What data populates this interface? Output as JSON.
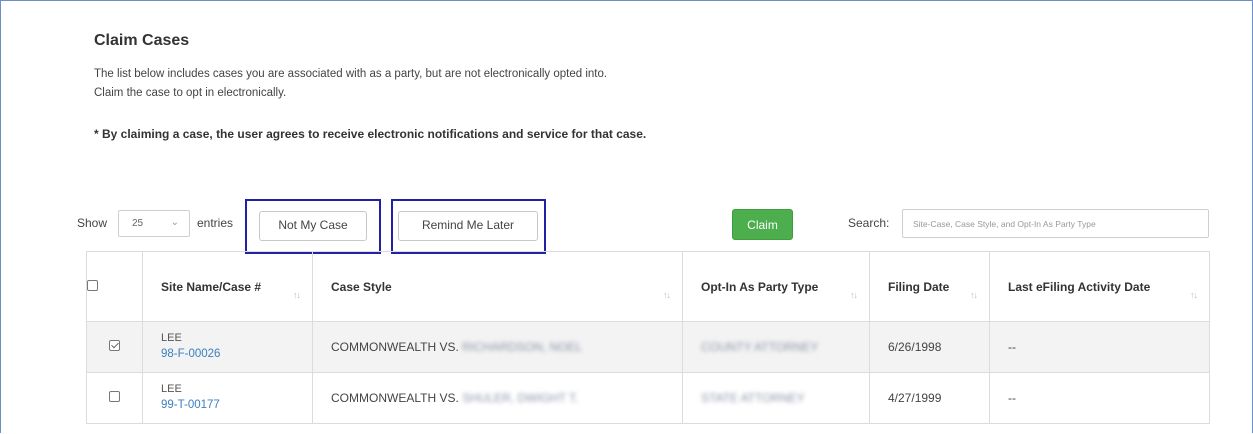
{
  "page": {
    "title": "Claim Cases",
    "description": "The list below includes cases you are associated with as a party, but are not electronically opted into. Claim the case to opt in electronically.",
    "notice": "* By claiming a case, the user agrees to receive electronic notifications and service for that case."
  },
  "controls": {
    "show_label": "Show",
    "entries_value": "25",
    "entries_label": "entries",
    "not_my_case_label": "Not My Case",
    "remind_me_later_label": "Remind Me Later",
    "claim_label": "Claim",
    "search_label": "Search:",
    "search_placeholder": "Site-Case, Case Style, and Opt-In As Party Type"
  },
  "table": {
    "headers": {
      "site_case": "Site Name/Case #",
      "case_style": "Case Style",
      "party_type": "Opt-In As Party Type",
      "filing_date": "Filing Date",
      "last_activity": "Last eFiling Activity Date"
    },
    "sort_icon": "sort-icon",
    "rows": [
      {
        "checked": true,
        "site": "LEE",
        "case_number": "98-F-00026",
        "case_style": "COMMONWEALTH VS.",
        "case_style_redacted": "RICHARDSON, NOEL",
        "party_type_redacted": "COUNTY ATTORNEY",
        "filing_date": "6/26/1998",
        "last_activity": "--"
      },
      {
        "checked": false,
        "site": "LEE",
        "case_number": "99-T-00177",
        "case_style": "COMMONWEALTH VS.",
        "case_style_redacted": "SHULER, DWIGHT T.",
        "party_type_redacted": "STATE ATTORNEY",
        "filing_date": "4/27/1999",
        "last_activity": "--"
      }
    ]
  },
  "colors": {
    "claim_button": "#4cae4c",
    "highlight_box": "#2121a6",
    "link": "#3a7fc1",
    "frame_border": "#6b8fc7"
  }
}
